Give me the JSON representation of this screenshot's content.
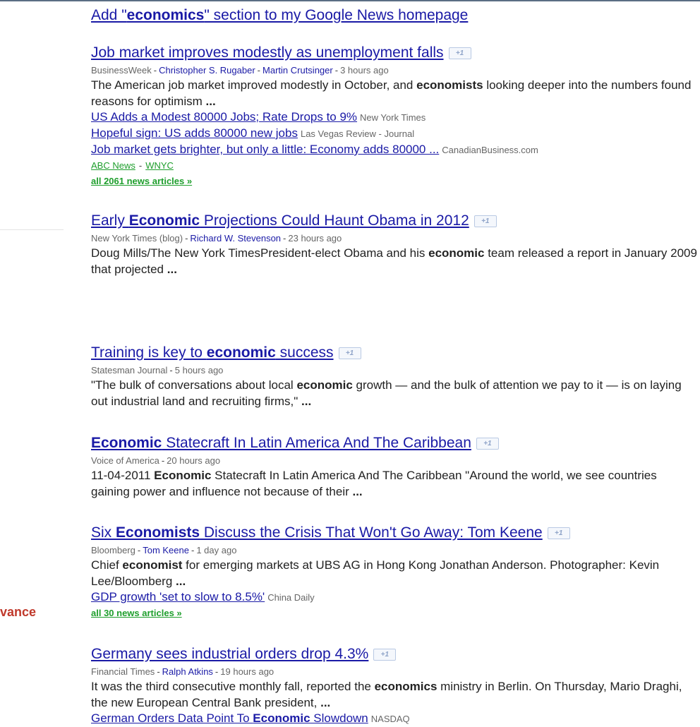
{
  "header": {
    "add_prefix": "Add \"",
    "add_term": "economics",
    "add_suffix": "\" section to my Google News homepage"
  },
  "left_label": "vance",
  "plus_one_label": "+1",
  "dash": "-",
  "stories": [
    {
      "title_parts": [
        {
          "t": "Job market improves modestly as unemployment falls",
          "b": false
        }
      ],
      "source": "BusinessWeek",
      "authors": [
        "Christopher S. Rugaber",
        "Martin Crutsinger"
      ],
      "time": "3 hours ago",
      "snippet_parts": [
        {
          "t": "The American job market improved modestly in October, and ",
          "b": false
        },
        {
          "t": "economists",
          "b": true
        },
        {
          "t": " looking deeper into the numbers found reasons for optimism ",
          "b": false
        },
        {
          "t": "...",
          "b": true
        }
      ],
      "related": [
        {
          "title": "US Adds a Modest 80000 Jobs; Rate Drops to 9%",
          "source": "New York Times"
        },
        {
          "title": "Hopeful sign: US adds 80000 new jobs",
          "source": "Las Vegas Review - Journal"
        },
        {
          "title": "Job market gets brighter, but only a little: Economy adds 80000 ...",
          "source": "CanadianBusiness.com"
        }
      ],
      "more_sources": [
        "ABC News",
        "WNYC"
      ],
      "all_articles": "all 2061 news articles »"
    },
    {
      "title_parts": [
        {
          "t": "Early ",
          "b": false
        },
        {
          "t": "Economic",
          "b": true
        },
        {
          "t": " Projections Could Haunt Obama in 2012",
          "b": false
        }
      ],
      "source": "New York Times (blog)",
      "authors": [
        "Richard W. Stevenson"
      ],
      "time": "23 hours ago",
      "snippet_parts": [
        {
          "t": "Doug Mills/The New York TimesPresident-elect Obama and his ",
          "b": false
        },
        {
          "t": "economic",
          "b": true
        },
        {
          "t": " team released a report in January 2009 that projected ",
          "b": false
        },
        {
          "t": "...",
          "b": true
        }
      ]
    },
    {
      "title_parts": [
        {
          "t": "Training is key to ",
          "b": false
        },
        {
          "t": "economic",
          "b": true
        },
        {
          "t": " success",
          "b": false
        }
      ],
      "source": "Statesman Journal",
      "authors": [],
      "time": "5 hours ago",
      "snippet_parts": [
        {
          "t": "\"The bulk of conversations about local ",
          "b": false
        },
        {
          "t": "economic",
          "b": true
        },
        {
          "t": " growth — and the bulk of attention we pay to it — is on laying out industrial land and recruiting firms,\" ",
          "b": false
        },
        {
          "t": "...",
          "b": true
        }
      ]
    },
    {
      "title_parts": [
        {
          "t": "Economic",
          "b": true
        },
        {
          "t": " Statecraft In Latin America And The Caribbean",
          "b": false
        }
      ],
      "source": "Voice of America",
      "authors": [],
      "time": "20 hours ago",
      "snippet_parts": [
        {
          "t": "11-04-2011 ",
          "b": false
        },
        {
          "t": "Economic",
          "b": true
        },
        {
          "t": " Statecraft In Latin America And The Caribbean \"Around the world, we see countries gaining power and influence not because of their ",
          "b": false
        },
        {
          "t": "...",
          "b": true
        }
      ]
    },
    {
      "title_parts": [
        {
          "t": "Six ",
          "b": false
        },
        {
          "t": "Economists",
          "b": true
        },
        {
          "t": " Discuss the Crisis That Won't Go Away: Tom Keene",
          "b": false
        }
      ],
      "source": "Bloomberg",
      "authors": [
        "Tom Keene"
      ],
      "time": "1 day ago",
      "snippet_parts": [
        {
          "t": "Chief ",
          "b": false
        },
        {
          "t": "economist",
          "b": true
        },
        {
          "t": " for emerging markets at UBS AG in Hong Kong Jonathan Anderson. Photographer: Kevin Lee/Bloomberg ",
          "b": false
        },
        {
          "t": "...",
          "b": true
        }
      ],
      "related": [
        {
          "title": "GDP growth 'set to slow to 8.5%'",
          "source": "China Daily"
        }
      ],
      "all_articles": "all 30 news articles »"
    },
    {
      "title_parts": [
        {
          "t": "Germany sees industrial orders drop 4.3%",
          "b": false
        }
      ],
      "source": "Financial Times",
      "authors": [
        "Ralph Atkins"
      ],
      "time": "19 hours ago",
      "snippet_parts": [
        {
          "t": "It was the third consecutive monthly fall, reported the ",
          "b": false
        },
        {
          "t": "economics",
          "b": true
        },
        {
          "t": " ministry in Berlin. On Thursday, Mario Draghi, the new European Central Bank president, ",
          "b": false
        },
        {
          "t": "...",
          "b": true
        }
      ],
      "related": [
        {
          "title_parts": [
            {
              "t": "German Orders Data Point To ",
              "b": false
            },
            {
              "t": "Economic",
              "b": true
            },
            {
              "t": " Slowdown",
              "b": false
            }
          ],
          "source": "NASDAQ"
        }
      ]
    }
  ]
}
